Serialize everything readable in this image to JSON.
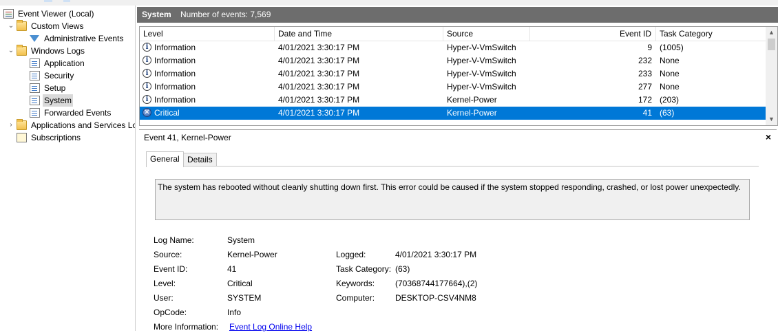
{
  "tree": {
    "root": "Event Viewer (Local)",
    "custom_views": "Custom Views",
    "administrative_events": "Administrative Events",
    "windows_logs": "Windows Logs",
    "application": "Application",
    "security": "Security",
    "setup": "Setup",
    "system": "System",
    "forwarded_events": "Forwarded Events",
    "apps_services": "Applications and Services Lo",
    "subscriptions": "Subscriptions"
  },
  "header": {
    "title": "System",
    "count": "Number of events: 7,569"
  },
  "columns": {
    "level": "Level",
    "datetime": "Date and Time",
    "source": "Source",
    "event_id": "Event ID",
    "task_category": "Task Category"
  },
  "rows": [
    {
      "level": "Information",
      "datetime": "4/01/2021 3:30:17 PM",
      "source": "Hyper-V-VmSwitch",
      "event_id": "9",
      "task_category": "(1005)"
    },
    {
      "level": "Information",
      "datetime": "4/01/2021 3:30:17 PM",
      "source": "Hyper-V-VmSwitch",
      "event_id": "232",
      "task_category": "None"
    },
    {
      "level": "Information",
      "datetime": "4/01/2021 3:30:17 PM",
      "source": "Hyper-V-VmSwitch",
      "event_id": "233",
      "task_category": "None"
    },
    {
      "level": "Information",
      "datetime": "4/01/2021 3:30:17 PM",
      "source": "Hyper-V-VmSwitch",
      "event_id": "277",
      "task_category": "None"
    },
    {
      "level": "Information",
      "datetime": "4/01/2021 3:30:17 PM",
      "source": "Kernel-Power",
      "event_id": "172",
      "task_category": "(203)"
    },
    {
      "level": "Critical",
      "datetime": "4/01/2021 3:30:17 PM",
      "source": "Kernel-Power",
      "event_id": "41",
      "task_category": "(63)"
    }
  ],
  "details": {
    "title": "Event 41, Kernel-Power",
    "tab_general": "General",
    "tab_details": "Details",
    "message": "The system has rebooted without cleanly shutting down first. This error could be caused if the system stopped responding, crashed, or lost power unexpectedly.",
    "labels": {
      "log_name": "Log Name:",
      "source": "Source:",
      "event_id": "Event ID:",
      "level": "Level:",
      "user": "User:",
      "opcode": "OpCode:",
      "more_info": "More Information:",
      "logged": "Logged:",
      "task_category": "Task Category:",
      "keywords": "Keywords:",
      "computer": "Computer:"
    },
    "values": {
      "log_name": "System",
      "source": "Kernel-Power",
      "event_id": "41",
      "level": "Critical",
      "user": "SYSTEM",
      "opcode": "Info",
      "more_info": "Event Log Online Help",
      "logged": "4/01/2021 3:30:17 PM",
      "task_category": "(63)",
      "keywords": "(70368744177664),(2)",
      "computer": "DESKTOP-CSV4NM8"
    }
  },
  "icons": {
    "close": "×",
    "info": "i",
    "critical": "✕",
    "expand": "›",
    "collapse": "⌄",
    "scroll_up": "▲",
    "scroll_down": "▼"
  },
  "colors": {
    "header_bg": "#6d6d6d",
    "selection": "#0078d7",
    "link": "#0000ee"
  }
}
